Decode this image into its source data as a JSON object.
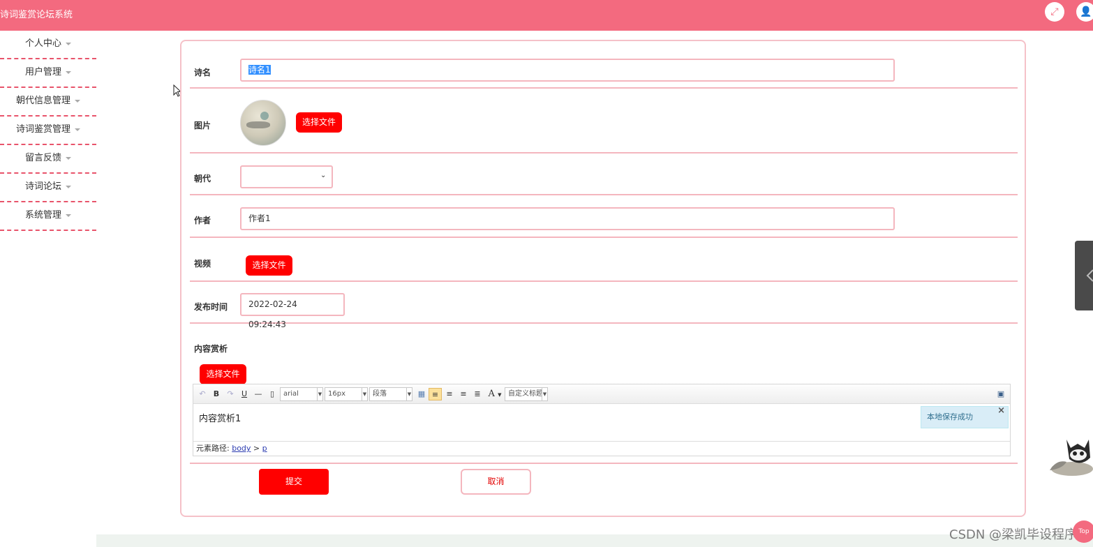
{
  "header": {
    "app_title": "诗词鉴赏论坛系统",
    "fullscreen_icon": "expand-icon",
    "user_icon": "user-icon"
  },
  "sidebar": {
    "items": [
      {
        "label": "个人中心"
      },
      {
        "label": "用户管理"
      },
      {
        "label": "朝代信息管理"
      },
      {
        "label": "诗词鉴赏管理"
      },
      {
        "label": "留言反馈"
      },
      {
        "label": "诗词论坛"
      },
      {
        "label": "系统管理"
      }
    ]
  },
  "form": {
    "poem_name": {
      "label": "诗名",
      "value": "诗名1"
    },
    "image": {
      "label": "图片",
      "button": "选择文件"
    },
    "dynasty": {
      "label": "朝代",
      "value": ""
    },
    "author": {
      "label": "作者",
      "value": "作者1"
    },
    "video": {
      "label": "视频",
      "button": "选择文件"
    },
    "publish_time": {
      "label": "发布时间",
      "value": "2022-02-24 09:24:43"
    },
    "content": {
      "label": "内容赏析",
      "button": "选择文件",
      "toolbar": {
        "bold": "B",
        "underline": "U",
        "font_family": "arial",
        "font_size": "16px",
        "paragraph": "段落",
        "font_color": "A",
        "custom_title": "自定义标题"
      },
      "body_text": "内容赏析1",
      "path_label": "元素路径:",
      "path_body": "body",
      "path_sep": " > ",
      "path_p": "p",
      "toast": "本地保存成功"
    },
    "submit": "提交",
    "cancel": "取消"
  },
  "overlay": {
    "watermark": "CSDN @梁凯毕设程序",
    "top_button": "Top"
  },
  "colors": {
    "brand": "#f36a7f",
    "button_red": "#ff0000",
    "border_pink": "#f4b6be"
  }
}
